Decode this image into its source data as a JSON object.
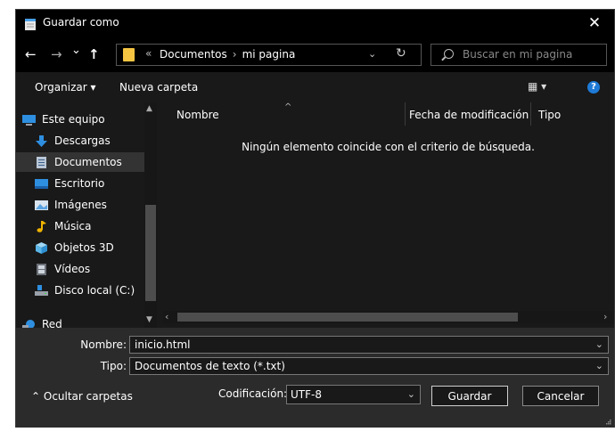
{
  "window": {
    "title": "Guardar como",
    "close_glyph": "✕"
  },
  "nav": {
    "back_glyph": "←",
    "forward_glyph": "→",
    "recent_glyph": "⌄",
    "up_glyph": "↑",
    "address": {
      "overflow": "«",
      "crumbs": [
        "Documentos",
        "mi pagina"
      ],
      "separator": "›",
      "dropdown_glyph": "⌄",
      "refresh_glyph": "↻"
    },
    "search_placeholder": "Buscar en mi pagina"
  },
  "toolbar": {
    "organize_label": "Organizar ▾",
    "new_folder_label": "Nueva carpeta",
    "view_glyph": "▦ ▾",
    "help_glyph": "?"
  },
  "sidebar": {
    "items": [
      {
        "label": "Este equipo",
        "icon": "computer-icon",
        "color": "#2e8fe0"
      },
      {
        "label": "Descargas",
        "icon": "downloads-icon",
        "color": "#2e8fe0"
      },
      {
        "label": "Documentos",
        "icon": "documents-icon",
        "color": "#b9c6d6",
        "selected": true
      },
      {
        "label": "Escritorio",
        "icon": "desktop-icon",
        "color": "#2e8fe0"
      },
      {
        "label": "Imágenes",
        "icon": "pictures-icon",
        "color": "#5aa3e0"
      },
      {
        "label": "Música",
        "icon": "music-icon",
        "color": "#f0b400"
      },
      {
        "label": "Objetos 3D",
        "icon": "objects-3d-icon",
        "color": "#5bb6e8"
      },
      {
        "label": "Vídeos",
        "icon": "videos-icon",
        "color": "#9aa0aa"
      },
      {
        "label": "Disco local (C:)",
        "icon": "local-disk-icon",
        "color": "#9aa0aa"
      },
      {
        "label": "Red",
        "icon": "network-icon",
        "color": "#2e8fe0"
      }
    ],
    "scroll_up_glyph": "▲",
    "scroll_down_glyph": "▼"
  },
  "filelist": {
    "columns": [
      "Nombre",
      "Fecha de modificación",
      "Tipo"
    ],
    "sort_glyph": "^",
    "empty_message": "Ningún elemento coincide con el criterio de búsqueda.",
    "scroll_left_glyph": "‹",
    "scroll_right_glyph": "›"
  },
  "form": {
    "filename_label": "Nombre:",
    "filename_value": "inicio.html",
    "type_label": "Tipo:",
    "type_value": "Documentos de texto (*.txt)",
    "dropdown_glyph": "⌄",
    "hide_folders_label": "⌃  Ocultar carpetas",
    "encoding_label": "Codificación:",
    "encoding_value": "UTF-8",
    "save_label": "Guardar",
    "cancel_label": "Cancelar"
  },
  "colors": {
    "background": "#191919",
    "titlebar": "#000000",
    "lower_panel": "#2b2b2b",
    "selection": "#333333",
    "folder": "#f5c542",
    "help": "#1e7ad6"
  }
}
